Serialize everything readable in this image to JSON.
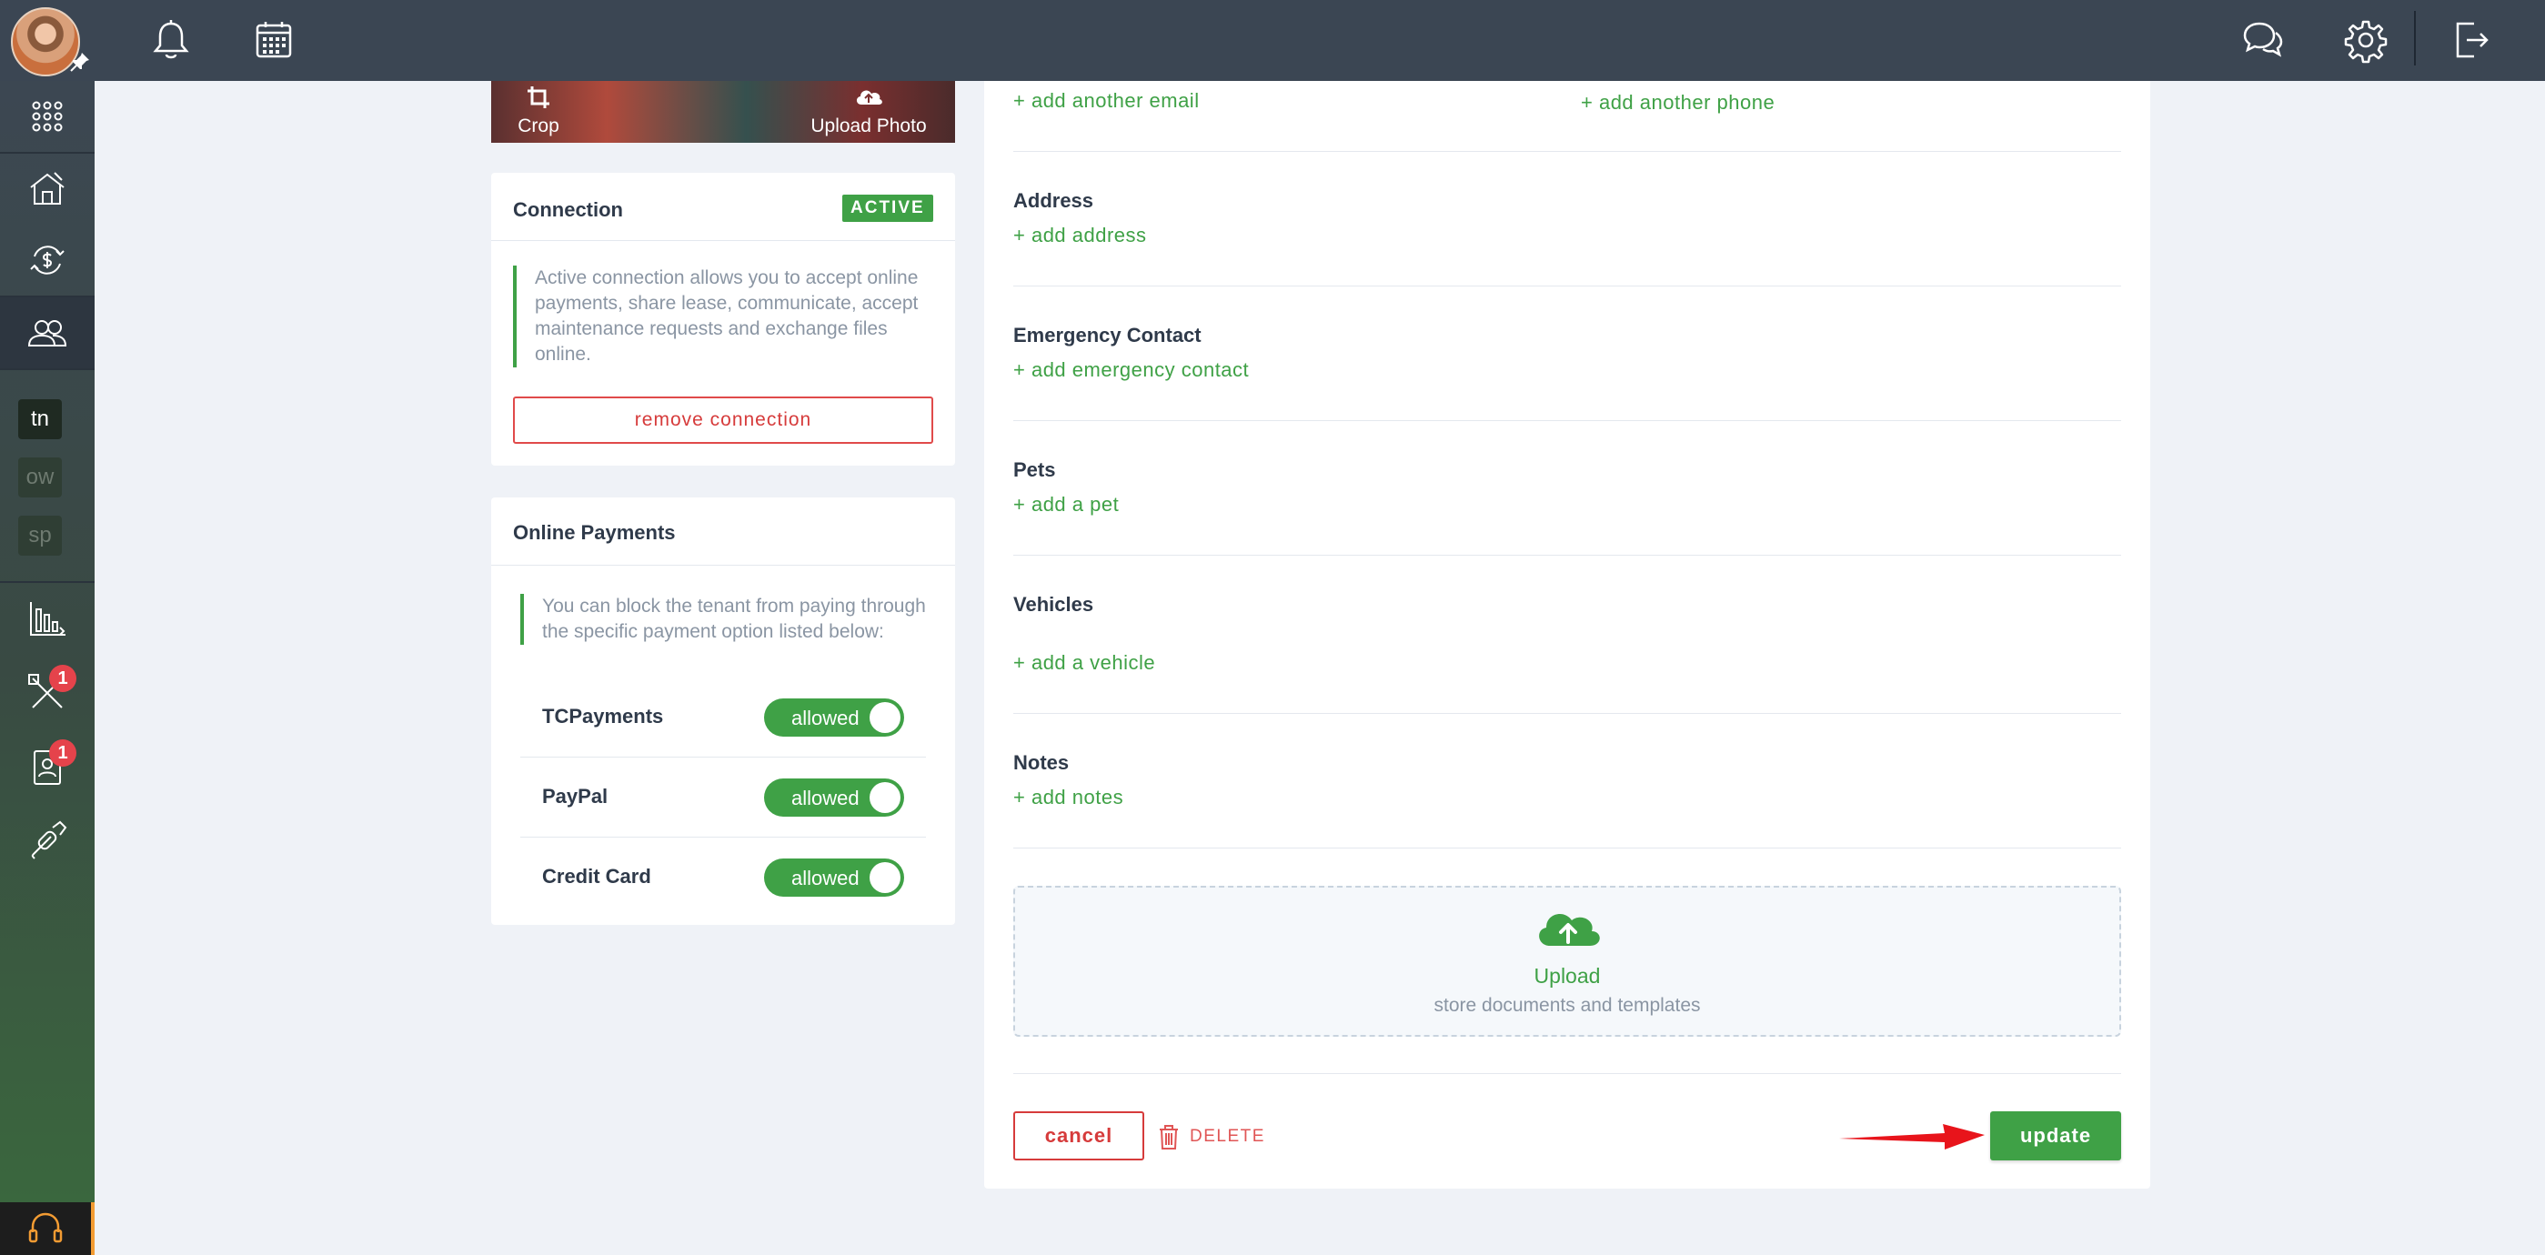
{
  "topbar": {
    "icons": [
      "bell-icon",
      "calendar-grid-icon",
      "chat-icon",
      "gear-icon",
      "logout-icon"
    ]
  },
  "sidebar": {
    "items": [
      {
        "name": "apps-grid-icon"
      },
      {
        "name": "property-house-icon"
      },
      {
        "name": "money-exchange-icon"
      },
      {
        "name": "people-icon",
        "active": true
      },
      {
        "name": "reports-chart-icon"
      },
      {
        "name": "maintenance-tools-icon",
        "badge": "1"
      },
      {
        "name": "applicant-contact-icon",
        "badge": "1"
      },
      {
        "name": "link-chain-icon"
      }
    ],
    "tags": [
      "tn",
      "ow",
      "sp"
    ],
    "support_icon": "headset-icon"
  },
  "photo": {
    "crop_label": "Crop",
    "upload_label": "Upload Photo"
  },
  "connection": {
    "title": "Connection",
    "status": "ACTIVE",
    "description": "Active connection allows you to accept online payments, share lease, communicate, accept maintenance requests and exchange files online.",
    "remove_label": "remove connection"
  },
  "online_payments": {
    "title": "Online Payments",
    "description": "You can block the tenant from paying through the specific payment option listed below:",
    "options": [
      {
        "label": "TCPayments",
        "state": "allowed"
      },
      {
        "label": "PayPal",
        "state": "allowed"
      },
      {
        "label": "Credit Card",
        "state": "allowed"
      }
    ]
  },
  "form": {
    "add_email": "+ add another email",
    "add_phone": "+ add another phone",
    "address": {
      "label": "Address",
      "add": "+ add address"
    },
    "emergency": {
      "label": "Emergency Contact",
      "add": "+ add emergency contact"
    },
    "pets": {
      "label": "Pets",
      "add": "+ add a pet"
    },
    "vehicles": {
      "label": "Vehicles",
      "add": "+ add a vehicle"
    },
    "notes": {
      "label": "Notes",
      "add": "+ add notes"
    },
    "upload": {
      "title": "Upload",
      "subtitle": "store documents and templates"
    },
    "cancel_label": "cancel",
    "delete_label": "DELETE",
    "update_label": "update"
  },
  "colors": {
    "accent": "#3fa146",
    "danger": "#d63b3b",
    "topbar": "#3b4653"
  }
}
